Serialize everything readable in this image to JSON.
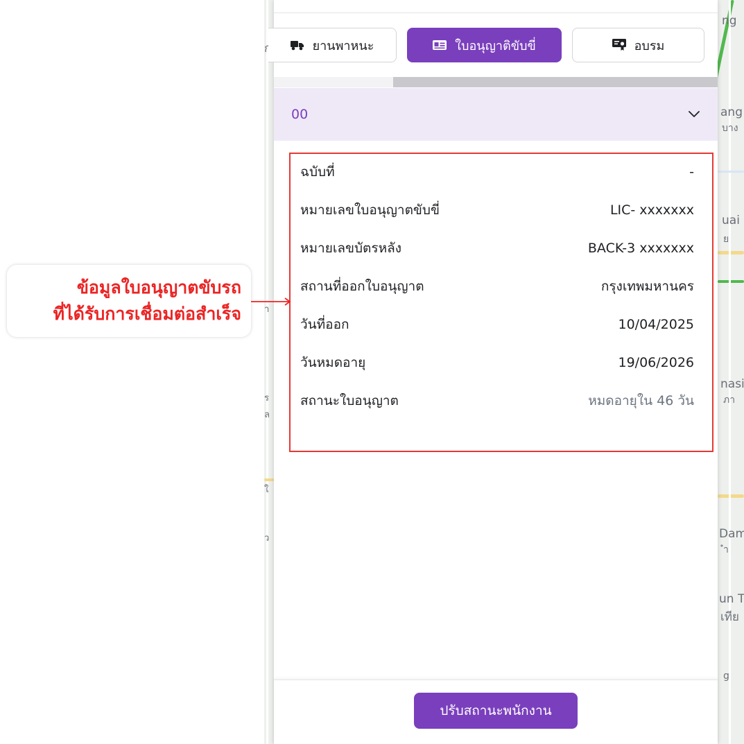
{
  "map": {
    "right_labels": [
      "ng",
      "ang",
      "บาง",
      "uai",
      "ย",
      "nasi",
      "ภา",
      "Dam",
      "ำ",
      "un T",
      "เทีย",
      "g"
    ],
    "left_labels": [
      "ก",
      "า",
      "ร",
      "ล",
      "ใ",
      "ว"
    ]
  },
  "tabs": [
    {
      "label": "ยานพาหนะ",
      "icon": "truck-icon",
      "active": false
    },
    {
      "label": "ใบอนุญาติขับขี่",
      "icon": "id-card-icon",
      "active": true
    },
    {
      "label": "อบรม",
      "icon": "certificate-icon",
      "active": false
    }
  ],
  "accordion": {
    "title": "00",
    "icon": "chevron-down-icon"
  },
  "license_details": [
    {
      "label": "ฉบับที่",
      "value": "-"
    },
    {
      "label": "หมายเลขใบอนุญาตขับขี่",
      "value": "LIC- xxxxxxx"
    },
    {
      "label": "หมายเลขบัตรหลัง",
      "value": "BACK-3 xxxxxxx"
    },
    {
      "label": "สถานที่ออกใบอนุญาต",
      "value": "กรุงเทพมหานคร"
    },
    {
      "label": "วันที่ออก",
      "value": "10/04/2025"
    },
    {
      "label": "วันหมดอายุ",
      "value": "19/06/2026"
    },
    {
      "label": "สถานะใบอนุญาต",
      "value": "หมดอายุใน 46 วัน"
    }
  ],
  "footer": {
    "button_label": "ปรับสถานะพนักงาน"
  },
  "annotation": {
    "line1": "ข้อมูลใบอนุญาตขับรถ",
    "line2": "ที่ได้รับการเชื่อมต่อสำเร็จ"
  },
  "colors": {
    "primary": "#7a3fbd",
    "accordion_bg": "#efe9f7",
    "highlight_border": "#e53935",
    "annotation_text": "#ec2424",
    "muted_value": "#6c7480"
  }
}
